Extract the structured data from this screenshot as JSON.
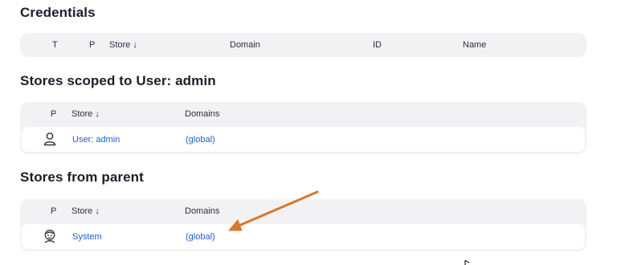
{
  "credentials": {
    "title": "Credentials",
    "columns": [
      "T",
      "P",
      "Store ↓",
      "Domain",
      "ID",
      "Name"
    ]
  },
  "user_stores": {
    "title": "Stores scoped to User: admin",
    "columns": [
      "P",
      "Store ↓",
      "Domains"
    ],
    "rows": [
      {
        "icon": "user-icon",
        "store": "User: admin",
        "domains": "(global)"
      }
    ]
  },
  "parent_stores": {
    "title": "Stores from parent",
    "columns": [
      "P",
      "Store ↓",
      "Domains"
    ],
    "rows": [
      {
        "icon": "jenkins-icon",
        "store": "System",
        "domains": "(global)"
      }
    ]
  },
  "colors": {
    "link": "#1d5fd1",
    "arrow": "#d9772c",
    "table_bg": "#f2f2f5"
  }
}
